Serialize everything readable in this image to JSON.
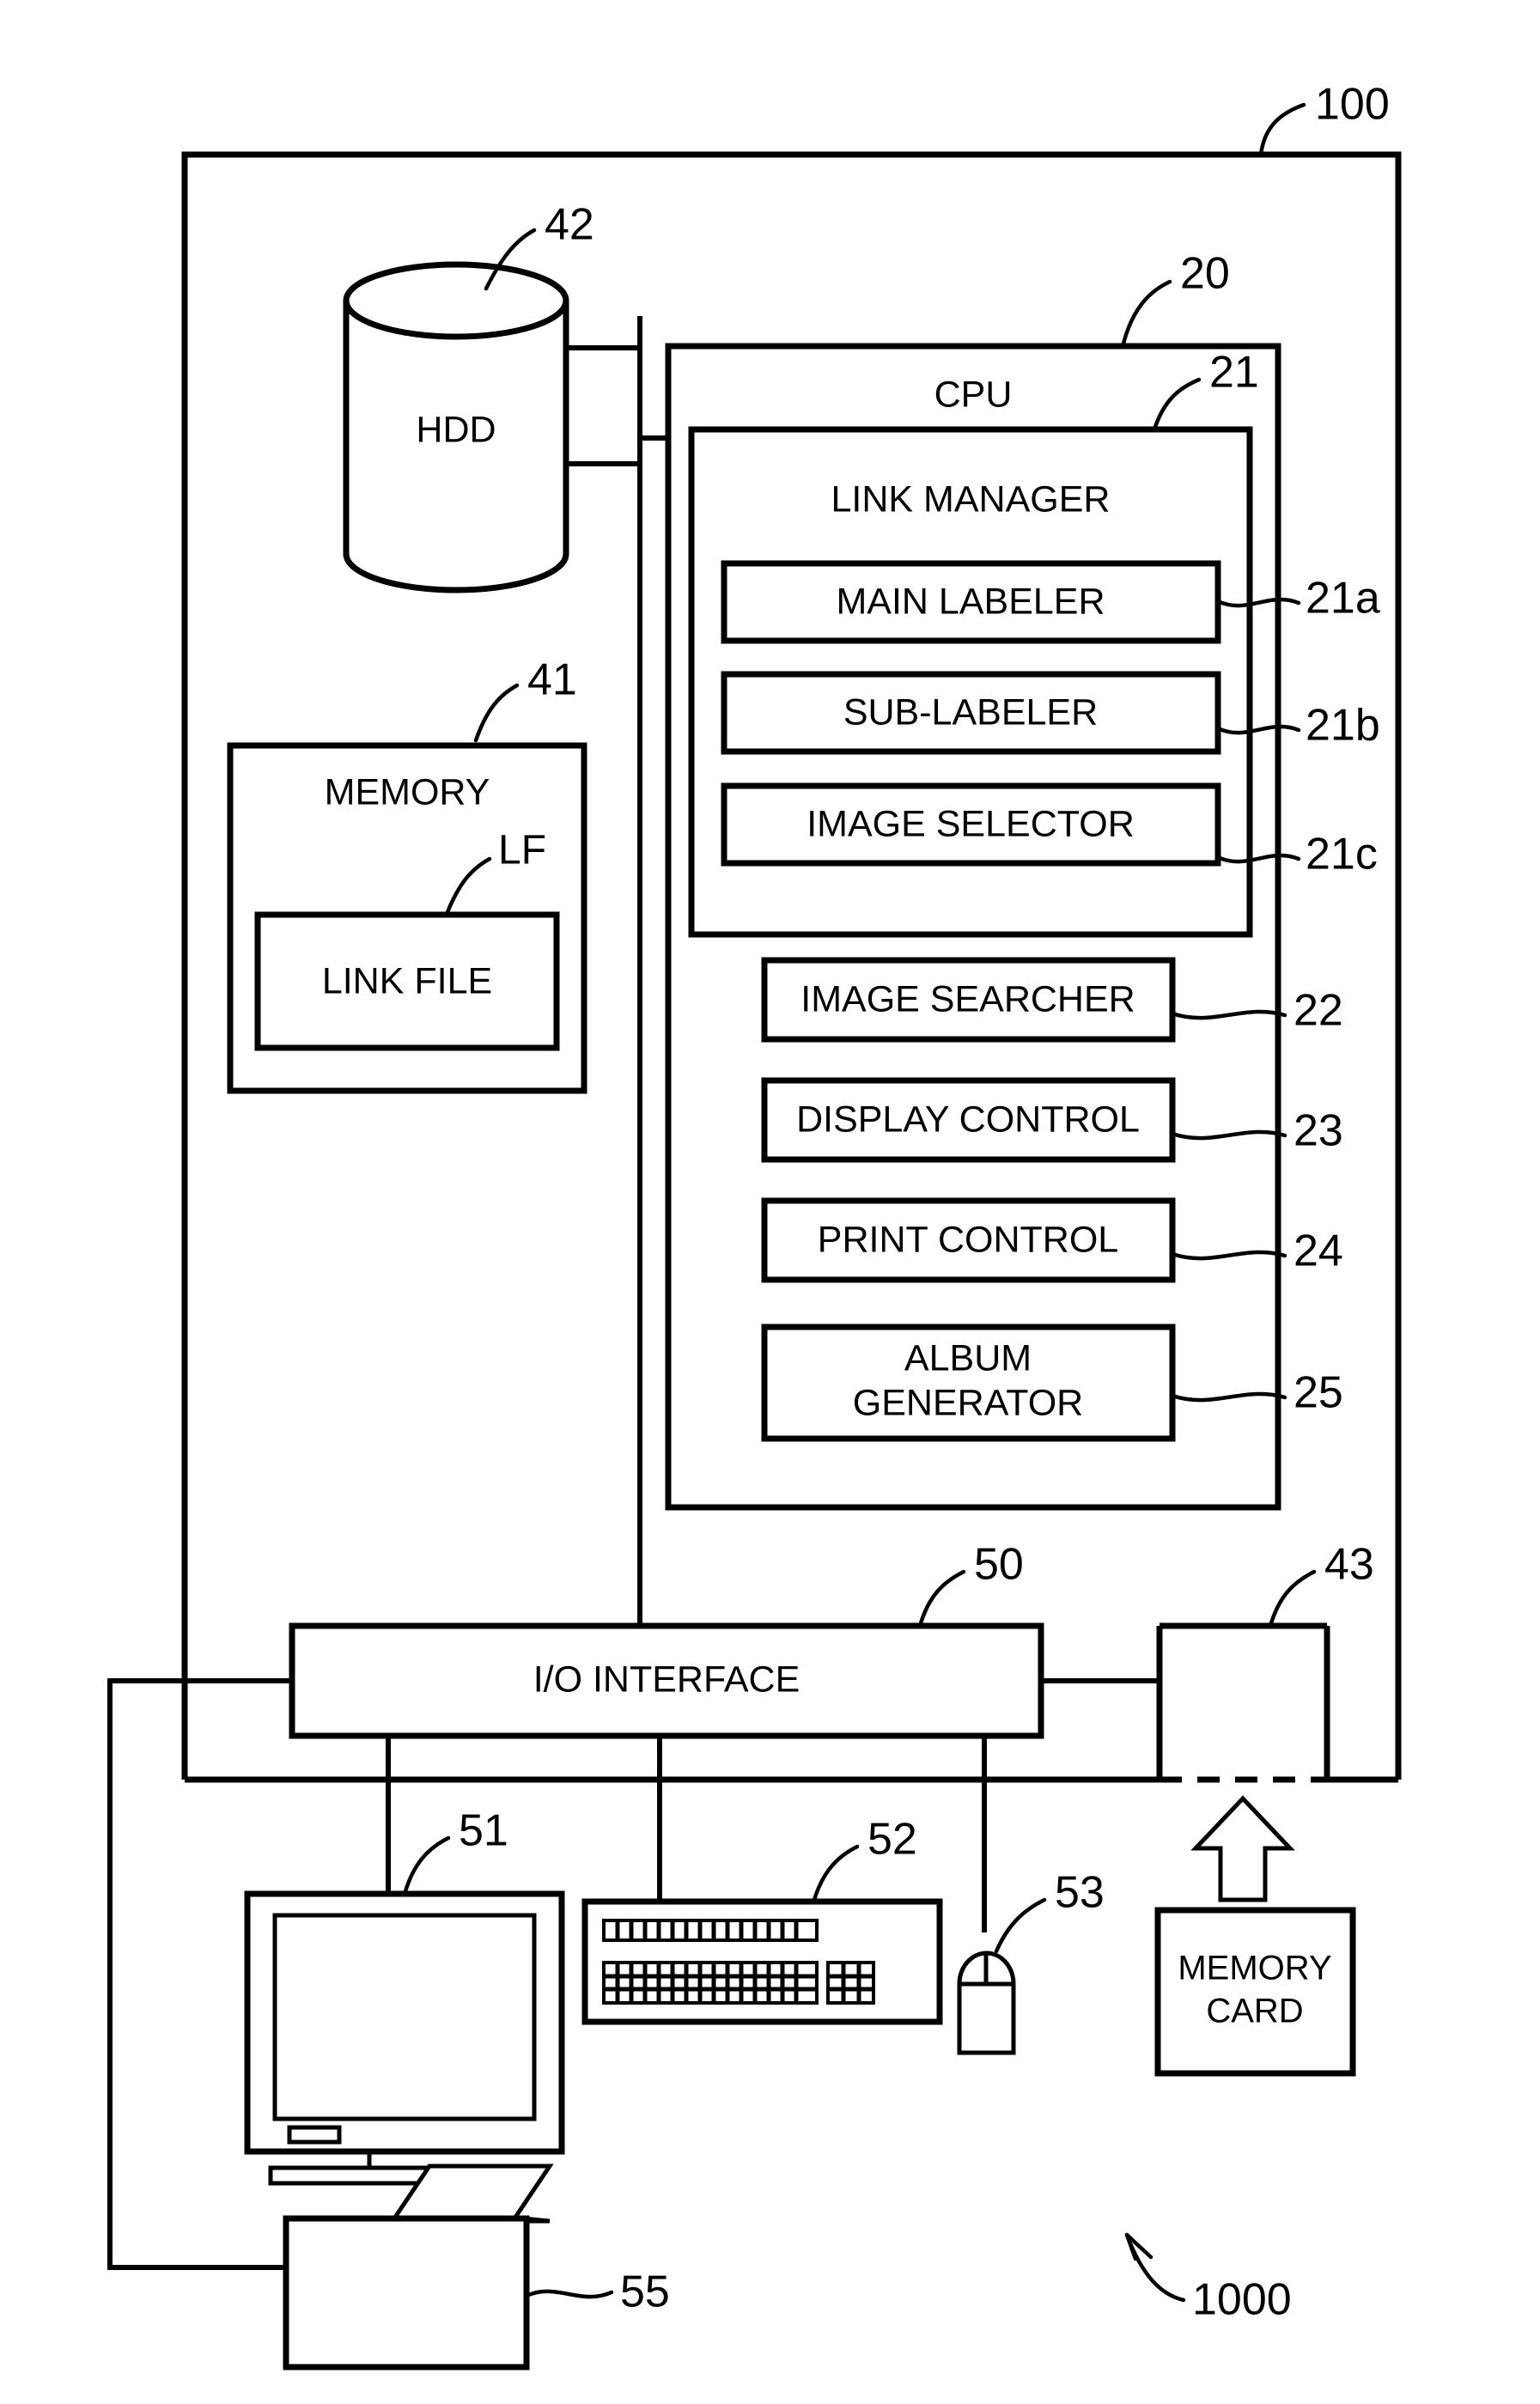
{
  "figure": {
    "system_label": "1000",
    "enclosure_label": "100"
  },
  "blocks": {
    "hdd": {
      "label": "HDD",
      "ref": "42"
    },
    "memory": {
      "label": "MEMORY",
      "ref": "41"
    },
    "link_file": {
      "label": "LINK FILE",
      "ref": "LF"
    },
    "cpu": {
      "label": "CPU",
      "ref": "20"
    },
    "link_manager": {
      "label": "LINK MANAGER",
      "ref": "21"
    },
    "main_labeler": {
      "label": "MAIN LABELER",
      "ref": "21a"
    },
    "sub_labeler": {
      "label": "SUB-LABELER",
      "ref": "21b"
    },
    "image_selector": {
      "label": "IMAGE SELECTOR",
      "ref": "21c"
    },
    "image_searcher": {
      "label": "IMAGE SEARCHER",
      "ref": "22"
    },
    "display_control": {
      "label": "DISPLAY CONTROL",
      "ref": "23"
    },
    "print_control": {
      "label": "PRINT CONTROL",
      "ref": "24"
    },
    "album_generator": {
      "label_line1": "ALBUM",
      "label_line2": "GENERATOR",
      "ref": "25"
    },
    "io_interface": {
      "label": "I/O INTERFACE",
      "ref": "50"
    },
    "card_slot": {
      "label": "",
      "ref": "43"
    },
    "memory_card": {
      "label_line1": "MEMORY",
      "label_line2": "CARD",
      "ref": ""
    },
    "monitor": {
      "label": "",
      "ref": "51"
    },
    "keyboard": {
      "label": "",
      "ref": "52"
    },
    "mouse": {
      "label": "",
      "ref": "53"
    },
    "printer": {
      "label": "",
      "ref": "55"
    }
  }
}
